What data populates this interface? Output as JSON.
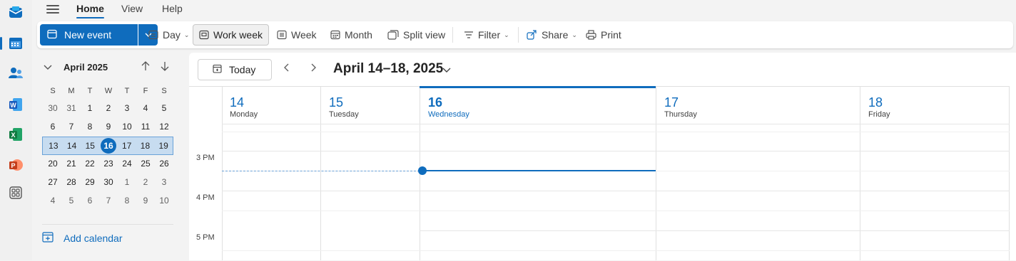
{
  "rail": {
    "items": [
      {
        "icon": "mail-icon"
      },
      {
        "icon": "calendar-icon"
      },
      {
        "icon": "people-icon"
      },
      {
        "icon": "word-icon"
      },
      {
        "icon": "excel-icon"
      },
      {
        "icon": "powerpoint-icon"
      },
      {
        "icon": "apps-icon"
      }
    ],
    "active": "calendar-icon"
  },
  "menu": {
    "tabs": [
      "Home",
      "View",
      "Help"
    ],
    "selected": "Home"
  },
  "toolbar": {
    "new_event": "New event",
    "day": "Day",
    "work_week": "Work week",
    "week": "Week",
    "month": "Month",
    "split_view": "Split view",
    "filter": "Filter",
    "share": "Share",
    "print": "Print",
    "selected_view": "Work week"
  },
  "mini_calendar": {
    "month_label": "April 2025",
    "weekdays": [
      "S",
      "M",
      "T",
      "W",
      "T",
      "F",
      "S"
    ],
    "weeks": [
      [
        "30",
        "31",
        "1",
        "2",
        "3",
        "4",
        "5"
      ],
      [
        "6",
        "7",
        "8",
        "9",
        "10",
        "11",
        "12"
      ],
      [
        "13",
        "14",
        "15",
        "16",
        "17",
        "18",
        "19"
      ],
      [
        "20",
        "21",
        "22",
        "23",
        "24",
        "25",
        "26"
      ],
      [
        "27",
        "28",
        "29",
        "30",
        "1",
        "2",
        "3"
      ],
      [
        "4",
        "5",
        "6",
        "7",
        "8",
        "9",
        "10"
      ]
    ],
    "today": "16",
    "selected_week_index": 2,
    "add_calendar": "Add calendar"
  },
  "main": {
    "today_button": "Today",
    "range_title": "April 14–18, 2025",
    "days": [
      {
        "num": "14",
        "name": "Monday"
      },
      {
        "num": "15",
        "name": "Tuesday"
      },
      {
        "num": "16",
        "name": "Wednesday"
      },
      {
        "num": "17",
        "name": "Thursday"
      },
      {
        "num": "18",
        "name": "Friday"
      }
    ],
    "current_day": "16",
    "time_labels": [
      "3 PM",
      "4 PM",
      "5 PM"
    ]
  },
  "colors": {
    "accent": "#0f6cbd",
    "selection": "#c7dcf0"
  }
}
